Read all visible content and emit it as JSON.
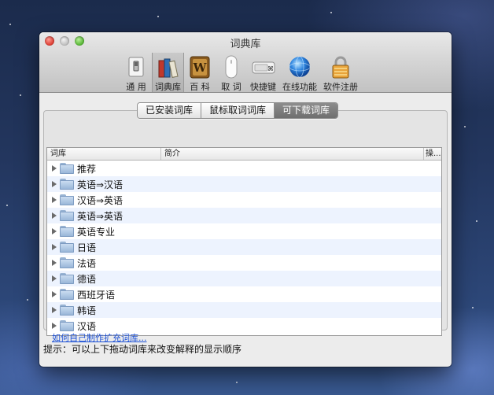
{
  "window": {
    "title": "词典库"
  },
  "toolbar": {
    "items": [
      {
        "label": "通 用",
        "icon": "switch-icon"
      },
      {
        "label": "词典库",
        "icon": "books-icon",
        "selected": true
      },
      {
        "label": "百 科",
        "icon": "wiki-icon"
      },
      {
        "label": "取 词",
        "icon": "mouse-icon"
      },
      {
        "label": "快捷键",
        "icon": "keyboard-icon"
      },
      {
        "label": "在线功能",
        "icon": "globe-icon"
      },
      {
        "label": "软件注册",
        "icon": "lock-icon"
      }
    ]
  },
  "tabs": [
    {
      "label": "已安装词库",
      "active": false
    },
    {
      "label": "鼠标取词词库",
      "active": false
    },
    {
      "label": "可下载词库",
      "active": true
    }
  ],
  "table": {
    "columns": [
      "词库",
      "简介",
      "操..."
    ],
    "rows": [
      "推荐",
      "英语⇒汉语",
      "汉语⇒英语",
      "英语⇒英语",
      "英语专业",
      "日语",
      "法语",
      "德语",
      "西班牙语",
      "韩语",
      "汉语"
    ]
  },
  "help_link": "如何自己制作扩充词库...",
  "tip": "提示：可以上下拖动词库来改变解释的显示顺序",
  "colors": {
    "link": "#1a4fd6",
    "alt_row": "#edf3fe",
    "active_segment": "#7a7a7a"
  }
}
